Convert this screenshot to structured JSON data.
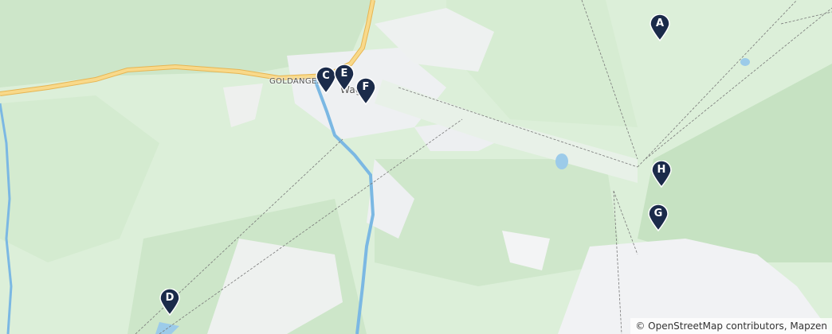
{
  "map": {
    "places": {
      "goldanger": "GOLDANGER",
      "town": "Wag"
    },
    "markers": [
      {
        "label": "A"
      },
      {
        "label": "C"
      },
      {
        "label": "E"
      },
      {
        "label": "F"
      },
      {
        "label": "H"
      },
      {
        "label": "G"
      },
      {
        "label": "D"
      }
    ],
    "attribution": "© OpenStreetMap contributors, Mapzen",
    "colors": {
      "marker": "#1b2b4a",
      "forest": "#cfe8cc",
      "light_green": "#e2f2de",
      "rock": "#f2f3f5",
      "water": "#7bb8e3",
      "road": "#f4c96a"
    }
  }
}
